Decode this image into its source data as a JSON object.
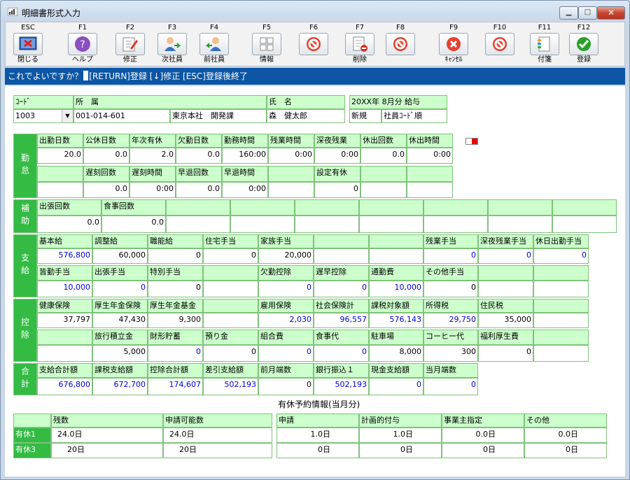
{
  "window": {
    "title": "明細書形式入力",
    "min": "▁",
    "max": "□",
    "close": "✕"
  },
  "toolbar": [
    {
      "key": "ESC",
      "label": "閉じる",
      "icon": "close-window-icon"
    },
    {
      "key": "F1",
      "label": "ヘルプ",
      "icon": "help-icon"
    },
    {
      "key": "F2",
      "label": "修正",
      "icon": "edit-icon"
    },
    {
      "key": "F3",
      "label": "次社員",
      "icon": "next-employee-icon"
    },
    {
      "key": "F4",
      "label": "前社員",
      "icon": "prev-employee-icon"
    },
    {
      "key": "F5",
      "label": "情報",
      "icon": "info-icon"
    },
    {
      "key": "F6",
      "label": "",
      "icon": "disabled-icon"
    },
    {
      "key": "F7",
      "label": "削除",
      "icon": "delete-icon"
    },
    {
      "key": "F8",
      "label": "",
      "icon": "disabled-icon"
    },
    {
      "key": "F9",
      "label": "ｷｬﾝｾﾙ",
      "icon": "cancel-icon"
    },
    {
      "key": "F10",
      "label": "",
      "icon": "disabled-icon"
    },
    {
      "key": "F11",
      "label": "付箋",
      "icon": "sticky-note-icon"
    },
    {
      "key": "F12",
      "label": "登録",
      "icon": "register-check-icon"
    }
  ],
  "status": {
    "prompt": "これでよいですか？",
    "rest": "[RETURN]登録 [↓]修正 [ESC]登録後終了"
  },
  "header": {
    "code_label": "ｺｰﾄﾞ",
    "code_value": "1003",
    "dept_label": "所　属",
    "dept_code": "001-014-601",
    "dept_name": "東京本社　開発課",
    "name_label": "氏　名",
    "name_value": "森　健太郎",
    "period": "20XX年 8月分 給与",
    "mode": "新規",
    "sort": "社員ｺｰﾄﾞ順"
  },
  "sections": {
    "kintai": "勤怠",
    "hojo": "補助",
    "shikyu": "支給",
    "kojo": "控除",
    "gokei": "合計"
  },
  "kintai": {
    "r1h": [
      "出勤日数",
      "公休日数",
      "年次有休",
      "欠勤日数",
      "勤務時間",
      "残業時間",
      "深夜残業",
      "休出回数",
      "休出時間"
    ],
    "r1v": [
      "20.0",
      "0.0",
      "2.0",
      "0.0",
      "160:00",
      "0:00",
      "0:00",
      "0.0",
      "0:00"
    ],
    "r2h": [
      "",
      "遅刻回数",
      "遅刻時間",
      "早退回数",
      "早退時間",
      "",
      "設定有休",
      "",
      ""
    ],
    "r2v": [
      "",
      "0.0",
      "0:00",
      "0.0",
      "0:00",
      "",
      "0",
      "",
      ""
    ]
  },
  "hojo": {
    "h": [
      "出張回数",
      "食事回数",
      "",
      "",
      "",
      "",
      "",
      "",
      ""
    ],
    "v": [
      "0.0",
      "0.0",
      "",
      "",
      "",
      "",
      "",
      "",
      ""
    ]
  },
  "shikyu": {
    "r1h": [
      "基本給",
      "調整給",
      "職能給",
      "住宅手当",
      "家族手当",
      "",
      "",
      "残業手当",
      "深夜残業手当",
      "休日出勤手当"
    ],
    "r1v": [
      "576,800",
      "60,000",
      "0",
      "0",
      "20,000",
      "",
      "",
      "0",
      "0",
      "0"
    ],
    "r1b": [
      true,
      false,
      false,
      false,
      false,
      false,
      false,
      true,
      true,
      true
    ],
    "r2h": [
      "皆勤手当",
      "出張手当",
      "特別手当",
      "",
      "欠勤控除",
      "遅早控除",
      "通勤費",
      "その他手当",
      "",
      ""
    ],
    "r2v": [
      "10,000",
      "0",
      "0",
      "",
      "0",
      "0",
      "10,000",
      "0",
      "",
      ""
    ],
    "r2b": [
      true,
      true,
      false,
      false,
      true,
      true,
      true,
      false,
      false,
      false
    ]
  },
  "kojo": {
    "r1h": [
      "健康保険",
      "厚生年金保険",
      "厚生年金基金",
      "",
      "雇用保険",
      "社会保険計",
      "課税対象額",
      "所得税",
      "住民税",
      ""
    ],
    "r1v": [
      "37,797",
      "47,430",
      "9,300",
      "",
      "2,030",
      "96,557",
      "576,143",
      "29,750",
      "35,000",
      ""
    ],
    "r1b": [
      false,
      false,
      false,
      false,
      true,
      true,
      true,
      true,
      false,
      false
    ],
    "r2h": [
      "",
      "旅行積立金",
      "財形貯蓄",
      "預り金",
      "組合費",
      "食事代",
      "駐車場",
      "コーヒー代",
      "福利厚生費",
      ""
    ],
    "r2v": [
      "",
      "5,000",
      "0",
      "0",
      "0",
      "0",
      "8,000",
      "300",
      "0",
      ""
    ],
    "r2b": [
      false,
      false,
      true,
      false,
      true,
      true,
      false,
      false,
      false,
      false
    ]
  },
  "gokei": {
    "h": [
      "支給合計額",
      "課税支給額",
      "控除合計額",
      "差引支給額",
      "前月端数",
      "銀行振込１",
      "現金支給額",
      "当月端数"
    ],
    "v": [
      "676,800",
      "672,700",
      "174,607",
      "502,193",
      "0",
      "502,193",
      "0",
      "0"
    ],
    "b": [
      true,
      true,
      true,
      true,
      false,
      true,
      true,
      true
    ]
  },
  "yukyu": {
    "title": "有休予約情報(当月分)",
    "left_h": [
      "残数",
      "申請可能数"
    ],
    "right_h": [
      "申請",
      "計画的付与",
      "事業主指定",
      "その他"
    ],
    "rows": [
      {
        "label": "有休1",
        "left": [
          "24.0日",
          "24.0日"
        ],
        "right": [
          "1.0日",
          "1.0日",
          "0.0日",
          "0.0日"
        ]
      },
      {
        "label": "有休3",
        "left": [
          "20日",
          "20日"
        ],
        "right": [
          "0日",
          "0日",
          "0日",
          "0日"
        ]
      }
    ]
  }
}
